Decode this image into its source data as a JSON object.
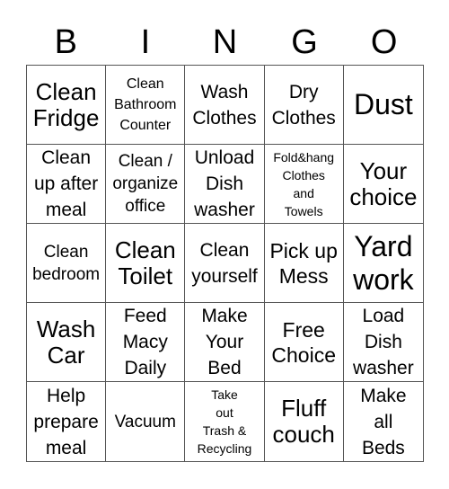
{
  "header": {
    "letters": [
      "B",
      "I",
      "N",
      "G",
      "O"
    ]
  },
  "grid": {
    "cells": [
      {
        "text": "Clean\nFridge",
        "size": "l"
      },
      {
        "text": "Clean\nBathroom\nCounter",
        "size": "xs"
      },
      {
        "text": "Wash\nClothes",
        "size": "m"
      },
      {
        "text": "Dry\nClothes",
        "size": "m"
      },
      {
        "text": "Dust",
        "size": "xl"
      },
      {
        "text": "Clean\nup after\nmeal",
        "size": "m"
      },
      {
        "text": "Clean /\norganize\noffice",
        "size": "s"
      },
      {
        "text": "Unload\nDish\nwasher",
        "size": "m"
      },
      {
        "text": "Fold&hang\nClothes\nand\nTowels",
        "size": "xxs"
      },
      {
        "text": "Your\nchoice",
        "size": "l"
      },
      {
        "text": "Clean\nbedroom",
        "size": "s"
      },
      {
        "text": "Clean\nToilet",
        "size": "l"
      },
      {
        "text": "Clean\nyourself",
        "size": "m"
      },
      {
        "text": "Pick up\nMess",
        "size": "ml"
      },
      {
        "text": "Yard\nwork",
        "size": "xl"
      },
      {
        "text": "Wash\nCar",
        "size": "l"
      },
      {
        "text": "Feed\nMacy\nDaily",
        "size": "m"
      },
      {
        "text": "Make\nYour\nBed",
        "size": "m"
      },
      {
        "text": "Free\nChoice",
        "size": "ml"
      },
      {
        "text": "Load\nDish\nwasher",
        "size": "m"
      },
      {
        "text": "Help\nprepare\nmeal",
        "size": "m"
      },
      {
        "text": "Vacuum",
        "size": "s"
      },
      {
        "text": "Take\nout\nTrash &\nRecycling",
        "size": "xxs"
      },
      {
        "text": "Fluff\ncouch",
        "size": "l"
      },
      {
        "text": "Make\nall\nBeds",
        "size": "m"
      }
    ]
  }
}
